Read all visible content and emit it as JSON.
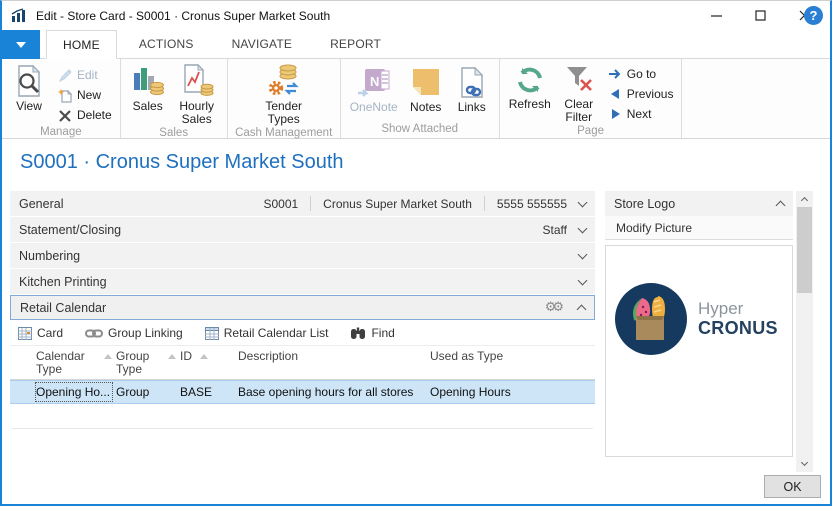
{
  "window": {
    "title": "Edit - Store Card - S0001 · Cronus Super Market South"
  },
  "tabs": [
    {
      "label": "HOME"
    },
    {
      "label": "ACTIONS"
    },
    {
      "label": "NAVIGATE"
    },
    {
      "label": "REPORT"
    }
  ],
  "ribbon": {
    "manage": {
      "label": "Manage",
      "view": "View",
      "edit": "Edit",
      "new": "New",
      "delete": "Delete"
    },
    "sales": {
      "label": "Sales",
      "sales": "Sales",
      "hourly_sales": "Hourly Sales"
    },
    "cash": {
      "label": "Cash Management",
      "tender_types": "Tender Types"
    },
    "show_attached": {
      "label": "Show Attached",
      "onenote": "OneNote",
      "notes": "Notes",
      "links": "Links"
    },
    "page": {
      "label": "Page",
      "refresh": "Refresh",
      "clear_filter": "Clear Filter",
      "go_to": "Go to",
      "previous": "Previous",
      "next": "Next"
    }
  },
  "page": {
    "title": "S0001 · Cronus Super Market South"
  },
  "fasttabs": {
    "general": {
      "label": "General",
      "summary": [
        "S0001",
        "Cronus Super Market South",
        "5555 555555"
      ]
    },
    "statement_closing": {
      "label": "Statement/Closing",
      "summary": [
        "Staff"
      ]
    },
    "numbering": {
      "label": "Numbering"
    },
    "kitchen_printing": {
      "label": "Kitchen Printing"
    },
    "retail_calendar": {
      "label": "Retail Calendar",
      "toolbar": [
        {
          "label": "Card"
        },
        {
          "label": "Group Linking"
        },
        {
          "label": "Retail Calendar List"
        },
        {
          "label": "Find"
        }
      ],
      "table": {
        "columns": [
          "Calendar Type",
          "Group Type",
          "ID",
          "Description",
          "Used as Type"
        ],
        "rows": [
          {
            "calendar_type": "Opening Ho...",
            "group_type": "Group",
            "id": "BASE",
            "description": "Base opening hours for all stores",
            "used_as_type": "Opening Hours"
          }
        ]
      }
    }
  },
  "side_panel": {
    "title": "Store Logo",
    "action": "Modify Picture",
    "logo_text_light": "Hyper",
    "logo_text_bold": "CRONUS"
  },
  "footer": {
    "ok_label": "OK"
  },
  "colors": {
    "accent_blue": "#1883d7",
    "title_blue": "#1e70bf",
    "selection": "#cde5f7",
    "navy": "#16395f"
  }
}
